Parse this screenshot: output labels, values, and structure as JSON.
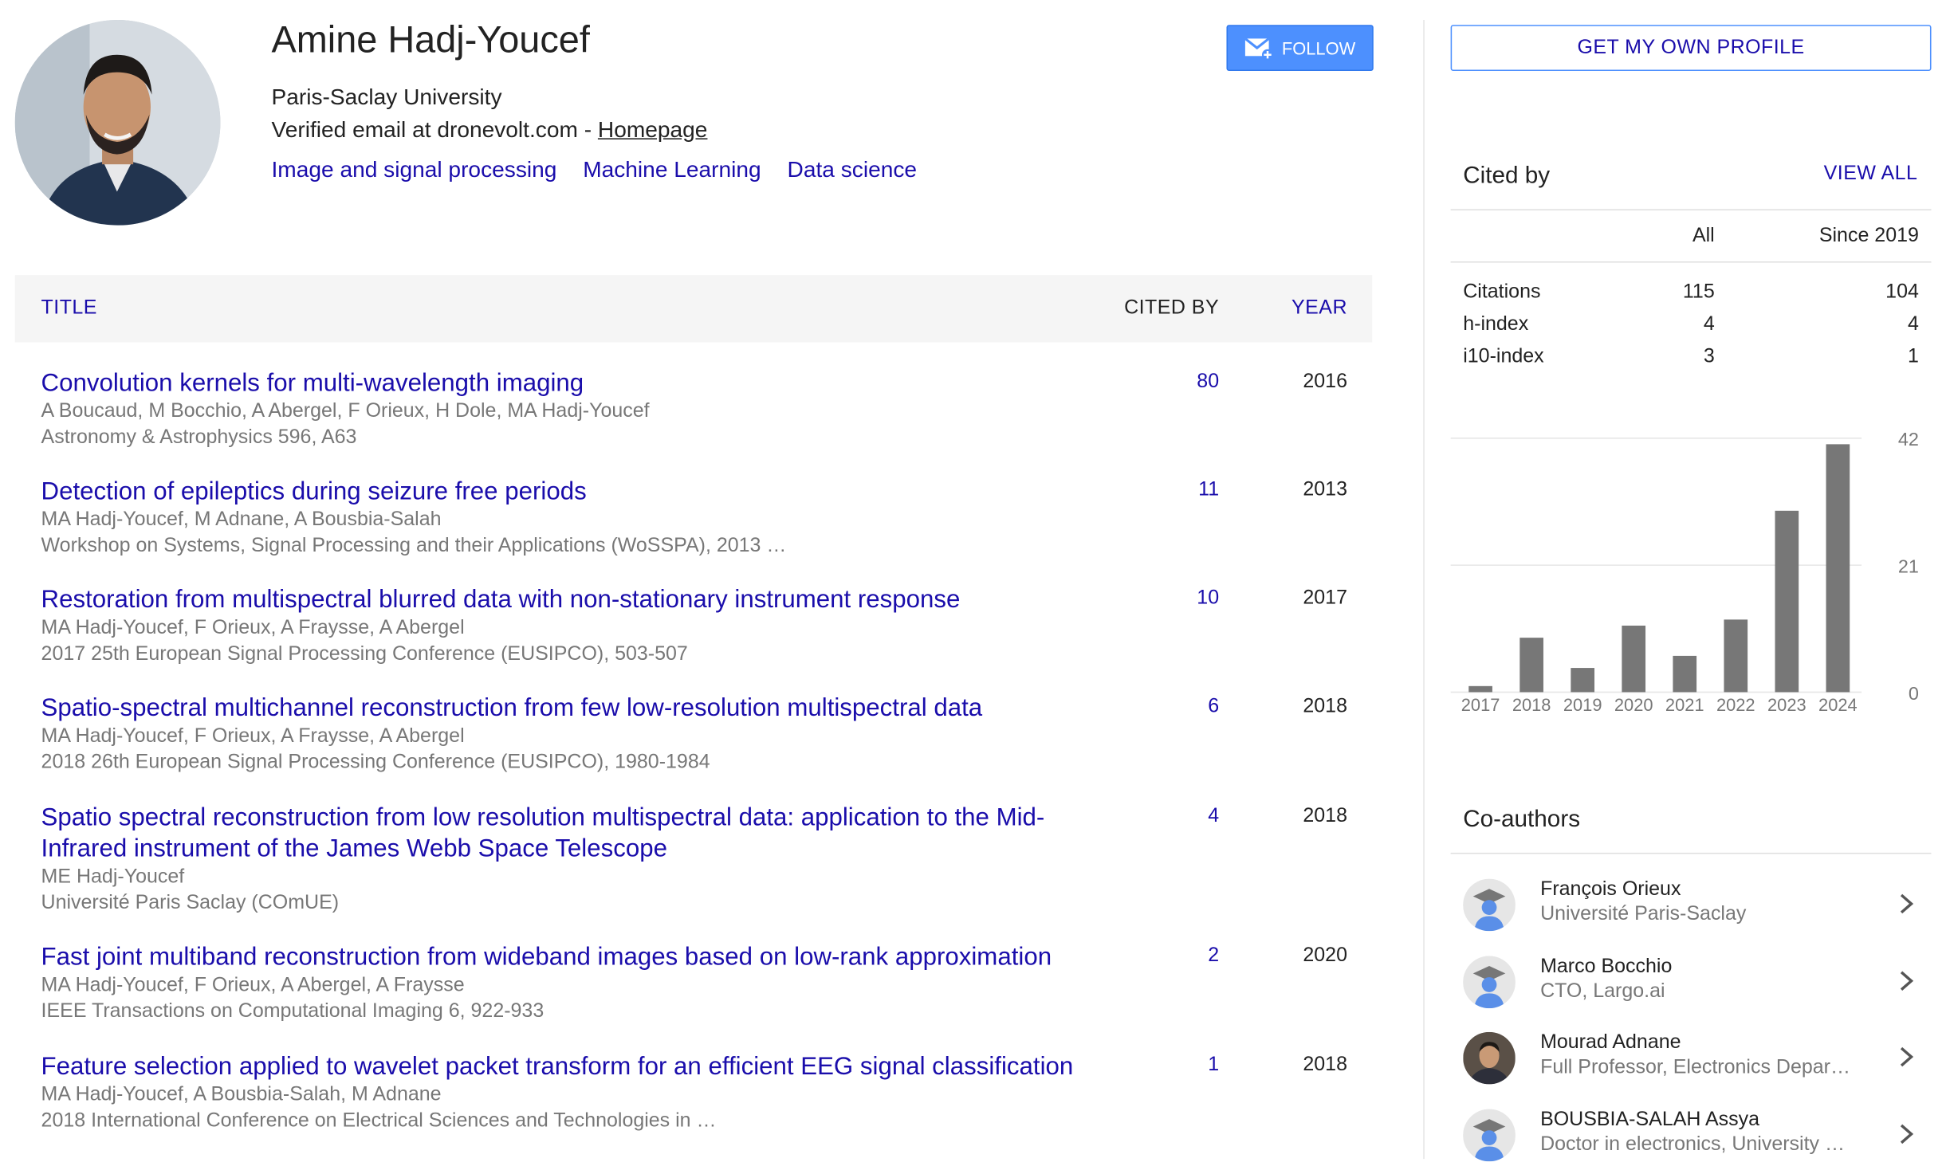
{
  "profile": {
    "name": "Amine Hadj-Youcef",
    "affiliation": "Paris-Saclay University",
    "email_text": "Verified email at dronevolt.com - ",
    "homepage": "Homepage",
    "interests": [
      "Image and signal processing",
      "Machine Learning",
      "Data science"
    ],
    "follow_label": "FOLLOW"
  },
  "table": {
    "col_title": "TITLE",
    "col_cited": "CITED BY",
    "col_year": "YEAR"
  },
  "articles": [
    {
      "title": "Convolution kernels for multi-wavelength imaging",
      "authors": "A Boucaud, M Bocchio, A Abergel, F Orieux, H Dole, MA Hadj-Youcef",
      "venue": "Astronomy & Astrophysics 596, A63",
      "cited": "80",
      "year": "2016"
    },
    {
      "title": "Detection of epileptics during seizure free periods",
      "authors": "MA Hadj-Youcef, M Adnane, A Bousbia-Salah",
      "venue": "Workshop on Systems, Signal Processing and their Applications (WoSSPA), 2013 …",
      "cited": "11",
      "year": "2013"
    },
    {
      "title": "Restoration from multispectral blurred data with non-stationary instrument response",
      "authors": "MA Hadj-Youcef, F Orieux, A Fraysse, A Abergel",
      "venue": "2017 25th European Signal Processing Conference (EUSIPCO), 503-507",
      "cited": "10",
      "year": "2017"
    },
    {
      "title": "Spatio-spectral multichannel reconstruction from few low-resolution multispectral data",
      "authors": "MA Hadj-Youcef, F Orieux, A Fraysse, A Abergel",
      "venue": "2018 26th European Signal Processing Conference (EUSIPCO), 1980-1984",
      "cited": "6",
      "year": "2018"
    },
    {
      "title": "Spatio spectral reconstruction from low resolution multispectral data: application to the Mid-Infrared instrument of the James Webb Space Telescope",
      "authors": "ME Hadj-Youcef",
      "venue": "Université Paris Saclay (COmUE)",
      "cited": "4",
      "year": "2018"
    },
    {
      "title": "Fast joint multiband reconstruction from wideband images based on low-rank approximation",
      "authors": "MA Hadj-Youcef, F Orieux, A Abergel, A Fraysse",
      "venue": "IEEE Transactions on Computational Imaging 6, 922-933",
      "cited": "2",
      "year": "2020"
    },
    {
      "title": "Feature selection applied to wavelet packet transform for an efficient EEG signal classification",
      "authors": "MA Hadj-Youcef, A Bousbia-Salah, M Adnane",
      "venue": "2018 International Conference on Electrical Sciences and Technologies in …",
      "cited": "1",
      "year": "2018"
    }
  ],
  "sidebar": {
    "get_profile": "GET MY OWN PROFILE",
    "cited_by": {
      "title": "Cited by",
      "view_all": "VIEW ALL",
      "col_all": "All",
      "col_since": "Since 2019",
      "rows": [
        {
          "label": "Citations",
          "all": "115",
          "since": "104"
        },
        {
          "label": "h-index",
          "all": "4",
          "since": "4"
        },
        {
          "label": "i10-index",
          "all": "3",
          "since": "1"
        }
      ]
    },
    "coauthors_title": "Co-authors",
    "coauthors": [
      {
        "name": "François Orieux",
        "affiliation": "Université Paris-Saclay",
        "avatar": "placeholder-avatar-icon"
      },
      {
        "name": "Marco Bocchio",
        "affiliation": "CTO, Largo.ai",
        "avatar": "placeholder-avatar-icon"
      },
      {
        "name": "Mourad Adnane",
        "affiliation": "Full Professor, Electronics Depar…",
        "avatar": "photo"
      },
      {
        "name": "BOUSBIA-SALAH Assya",
        "affiliation": "Doctor in electronics, University …",
        "avatar": "placeholder-avatar-icon"
      }
    ]
  },
  "colors": {
    "link": "#1a0dab",
    "button": "#4d90fe",
    "bar": "#777777",
    "muted": "#777777"
  },
  "chart_data": {
    "type": "bar",
    "categories": [
      "2017",
      "2018",
      "2019",
      "2020",
      "2021",
      "2022",
      "2023",
      "2024"
    ],
    "values": [
      1,
      9,
      4,
      11,
      6,
      12,
      30,
      41
    ],
    "yticks": [
      0,
      21,
      42
    ],
    "ylim": [
      0,
      42
    ],
    "title": "",
    "xlabel": "",
    "ylabel": "",
    "grid": true
  }
}
